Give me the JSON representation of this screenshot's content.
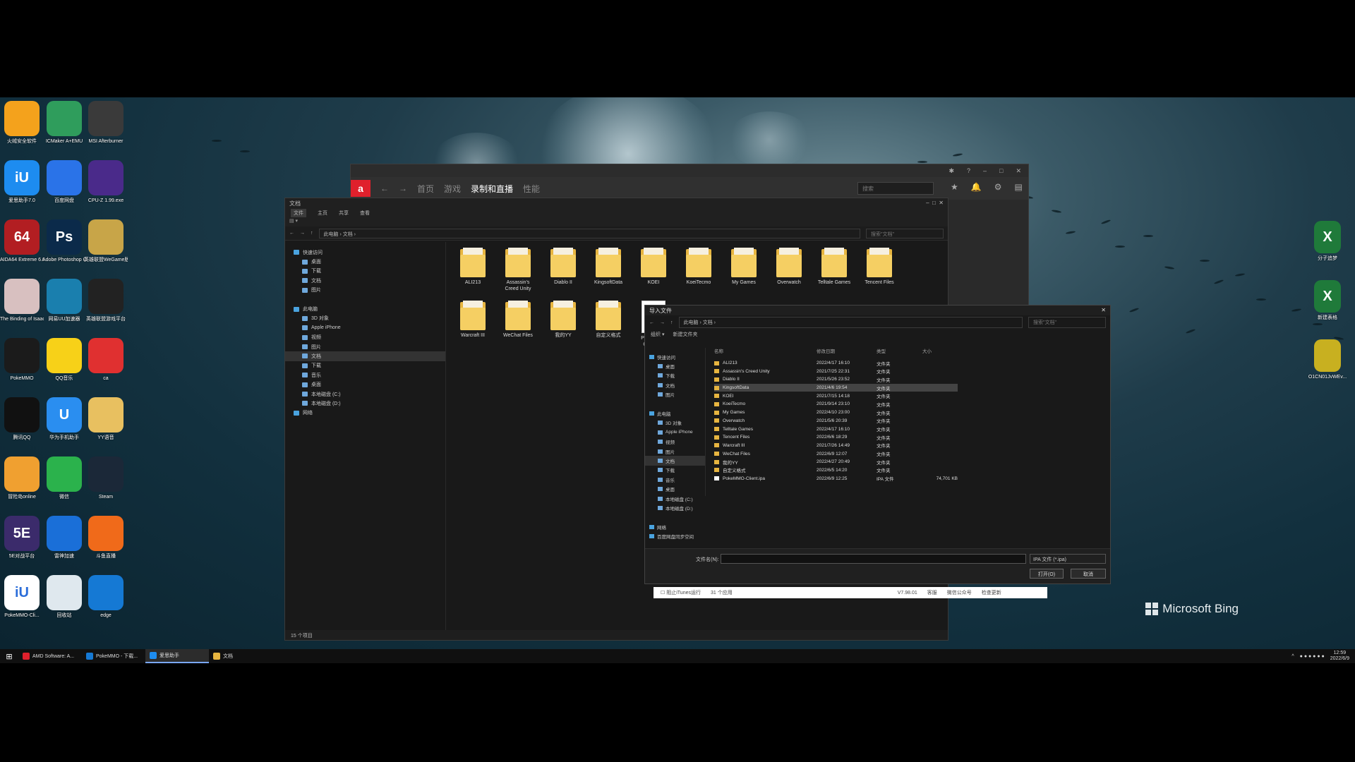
{
  "desktop": {
    "icons_left": [
      {
        "label": "火绒安全软件",
        "glyph": "",
        "color": "#f4a21c"
      },
      {
        "label": "ICMaker A+EMU",
        "glyph": "",
        "color": "#2f9d5c"
      },
      {
        "label": "MSI Afterburner",
        "glyph": "",
        "color": "#3a3a3a"
      },
      {
        "label": "爱思助手7.0",
        "glyph": "iU",
        "color": "#1d8cf0"
      },
      {
        "label": "百度网盘",
        "glyph": "",
        "color": "#2a73e8"
      },
      {
        "label": "CPU-Z 1.99.exe",
        "glyph": "",
        "color": "#4a2a8a"
      },
      {
        "label": "AIDA64 Extreme 6.60.exe",
        "glyph": "64",
        "color": "#b21e22"
      },
      {
        "label": "Adobe Photoshop CC",
        "glyph": "Ps",
        "color": "#0b2a4a"
      },
      {
        "label": "英雄联盟WeGame版",
        "glyph": "",
        "color": "#c8a548"
      },
      {
        "label": "The Binding of Isaac 启动",
        "glyph": "",
        "color": "#d8c0c0"
      },
      {
        "label": "网易UU加速器",
        "glyph": "",
        "color": "#1a7fae"
      },
      {
        "label": "英雄联盟游戏平台",
        "glyph": "",
        "color": "#222"
      },
      {
        "label": "PokeMMO",
        "glyph": "",
        "color": "#1b1b1b"
      },
      {
        "label": "QQ音乐",
        "glyph": "",
        "color": "#f7d118"
      },
      {
        "label": "ca",
        "glyph": "",
        "color": "#e03030"
      },
      {
        "label": "腾讯QQ",
        "glyph": "",
        "color": "#111"
      },
      {
        "label": "华为手机助手",
        "glyph": "U",
        "color": "#2a8ef0"
      },
      {
        "label": "YY语音",
        "glyph": "",
        "color": "#e8c060"
      },
      {
        "label": "冒险岛online",
        "glyph": "",
        "color": "#f0a030"
      },
      {
        "label": "微信",
        "glyph": "",
        "color": "#2bb24c"
      },
      {
        "label": "Steam",
        "glyph": "",
        "color": "#1b2838"
      },
      {
        "label": "5E对战平台",
        "glyph": "5E",
        "color": "#3b2b6b"
      },
      {
        "label": "雷神加速",
        "glyph": "",
        "color": "#1a6fd8"
      },
      {
        "label": "斗鱼直播",
        "glyph": "",
        "color": "#f06a1a"
      },
      {
        "label": "PokeMMO-Cli...",
        "glyph": "iU",
        "color": "#ffffff"
      },
      {
        "label": "回收站",
        "glyph": "",
        "color": "#dfe8ee"
      },
      {
        "label": "edge",
        "glyph": "",
        "color": "#1579d4"
      }
    ],
    "icons_right": [
      {
        "label": "分子追梦",
        "glyph": "X",
        "color": "#1f7a3a"
      },
      {
        "label": "新建表格",
        "glyph": "X",
        "color": "#1f7a3a"
      },
      {
        "label": "O1CN01JvWEv...",
        "glyph": "",
        "color": "#c8b020"
      }
    ],
    "bing_label": "Microsoft Bing"
  },
  "amd_window": {
    "logo": "a",
    "tabs": [
      "首页",
      "游戏",
      "录制和直播",
      "性能"
    ],
    "active_tab": "录制和直播",
    "search_placeholder": "搜索"
  },
  "explorer": {
    "title": "文档",
    "ribbon": [
      "文件",
      "主页",
      "共享",
      "查看"
    ],
    "path": [
      "此电脑",
      "文档"
    ],
    "search_placeholder": "搜索\"文档\"",
    "sidebar": [
      {
        "label": "快速访问",
        "level": 0
      },
      {
        "label": "桌面",
        "level": 1
      },
      {
        "label": "下载",
        "level": 1
      },
      {
        "label": "文档",
        "level": 1
      },
      {
        "label": "图片",
        "level": 1
      },
      {
        "label": "",
        "level": 1
      },
      {
        "label": "此电脑",
        "level": 0
      },
      {
        "label": "3D 对象",
        "level": 1
      },
      {
        "label": "Apple iPhone",
        "level": 1
      },
      {
        "label": "视频",
        "level": 1
      },
      {
        "label": "图片",
        "level": 1
      },
      {
        "label": "文档",
        "level": 1,
        "selected": true
      },
      {
        "label": "下载",
        "level": 1
      },
      {
        "label": "音乐",
        "level": 1
      },
      {
        "label": "桌面",
        "level": 1
      },
      {
        "label": "本地磁盘 (C:)",
        "level": 1
      },
      {
        "label": "本地磁盘 (D:)",
        "level": 1
      },
      {
        "label": "网络",
        "level": 0
      }
    ],
    "files": [
      {
        "name": "ALI213",
        "kind": "folder"
      },
      {
        "name": "Assassin's Creed Unity",
        "kind": "folder"
      },
      {
        "name": "Diablo II",
        "kind": "folder"
      },
      {
        "name": "KingsoftData",
        "kind": "folder"
      },
      {
        "name": "KOEI",
        "kind": "folder"
      },
      {
        "name": "KoeiTecmo",
        "kind": "folder"
      },
      {
        "name": "My Games",
        "kind": "folder"
      },
      {
        "name": "Overwatch",
        "kind": "folder"
      },
      {
        "name": "Telltale Games",
        "kind": "folder"
      },
      {
        "name": "Tencent Files",
        "kind": "folder"
      },
      {
        "name": "Warcraft III",
        "kind": "folder"
      },
      {
        "name": "WeChat Files",
        "kind": "folder"
      },
      {
        "name": "我的YY",
        "kind": "folder"
      },
      {
        "name": "自定义格式",
        "kind": "folder"
      },
      {
        "name": "PokeMMO-Client.ipa",
        "kind": "ipa"
      }
    ],
    "status": "15 个项目"
  },
  "dialog": {
    "title": "导入文件",
    "path": [
      "此电脑",
      "文档"
    ],
    "search_placeholder": "搜索\"文档\"",
    "toolbar": [
      "组织 ▾",
      "新建文件夹"
    ],
    "sidebar": [
      {
        "label": "快速访问",
        "level": 0
      },
      {
        "label": "桌面",
        "level": 1
      },
      {
        "label": "下载",
        "level": 1
      },
      {
        "label": "文档",
        "level": 1
      },
      {
        "label": "图片",
        "level": 1
      },
      {
        "label": "",
        "level": 1
      },
      {
        "label": "此电脑",
        "level": 0
      },
      {
        "label": "3D 对象",
        "level": 1
      },
      {
        "label": "Apple iPhone",
        "level": 1
      },
      {
        "label": "视频",
        "level": 1
      },
      {
        "label": "图片",
        "level": 1
      },
      {
        "label": "文档",
        "level": 1,
        "selected": true
      },
      {
        "label": "下载",
        "level": 1
      },
      {
        "label": "音乐",
        "level": 1
      },
      {
        "label": "桌面",
        "level": 1
      },
      {
        "label": "本地磁盘 (C:)",
        "level": 1
      },
      {
        "label": "本地磁盘 (D:)",
        "level": 1
      },
      {
        "label": "",
        "level": 1
      },
      {
        "label": "网络",
        "level": 0
      },
      {
        "label": "百度网盘同步空间",
        "level": 0
      }
    ],
    "columns": [
      "名称",
      "修改日期",
      "类型",
      "大小"
    ],
    "rows": [
      {
        "name": "ALI213",
        "date": "2022/4/17 16:10",
        "type": "文件夹",
        "size": "",
        "kind": "folder"
      },
      {
        "name": "Assassin's Creed Unity",
        "date": "2021/7/25 22:31",
        "type": "文件夹",
        "size": "",
        "kind": "folder"
      },
      {
        "name": "Diablo II",
        "date": "2021/5/26 23:52",
        "type": "文件夹",
        "size": "",
        "kind": "folder"
      },
      {
        "name": "KingsoftData",
        "date": "2021/4/6 19:54",
        "type": "文件夹",
        "size": "",
        "kind": "folder",
        "selected": true
      },
      {
        "name": "KOEI",
        "date": "2021/7/15 14:18",
        "type": "文件夹",
        "size": "",
        "kind": "folder"
      },
      {
        "name": "KoeiTecmo",
        "date": "2021/9/14 23:10",
        "type": "文件夹",
        "size": "",
        "kind": "folder"
      },
      {
        "name": "My Games",
        "date": "2022/4/10 23:00",
        "type": "文件夹",
        "size": "",
        "kind": "folder"
      },
      {
        "name": "Overwatch",
        "date": "2021/5/6 20:39",
        "type": "文件夹",
        "size": "",
        "kind": "folder"
      },
      {
        "name": "Telltale Games",
        "date": "2022/4/17 16:10",
        "type": "文件夹",
        "size": "",
        "kind": "folder"
      },
      {
        "name": "Tencent Files",
        "date": "2022/6/6 18:29",
        "type": "文件夹",
        "size": "",
        "kind": "folder"
      },
      {
        "name": "Warcraft III",
        "date": "2021/7/26 14:49",
        "type": "文件夹",
        "size": "",
        "kind": "folder"
      },
      {
        "name": "WeChat Files",
        "date": "2022/6/9 12:07",
        "type": "文件夹",
        "size": "",
        "kind": "folder"
      },
      {
        "name": "我的YY",
        "date": "2022/4/27 20:49",
        "type": "文件夹",
        "size": "",
        "kind": "folder"
      },
      {
        "name": "自定义格式",
        "date": "2022/6/5 14:20",
        "type": "文件夹",
        "size": "",
        "kind": "folder"
      },
      {
        "name": "PokeMMO-Client.ipa",
        "date": "2022/6/9 12:25",
        "type": "IPA 文件",
        "size": "74,701 KB",
        "kind": "file"
      }
    ],
    "filename_label": "文件名(N):",
    "filename_value": "",
    "filetype": "IPA 文件 (*.ipa)",
    "open_button": "打开(O)",
    "cancel_button": "取消"
  },
  "strip": {
    "items": [
      "阻止iTunes运行",
      "31 个应用",
      "V7.98.01",
      "客服",
      "微信公众号",
      "检查更新"
    ]
  },
  "taskbar": {
    "start": "⊞",
    "tasks": [
      {
        "label": "AMD Software: A...",
        "color": "#e0202c"
      },
      {
        "label": "PokeMMO - 下载...",
        "color": "#1579d4"
      },
      {
        "label": "爱思助手",
        "color": "#1d8cf0",
        "active": true
      },
      {
        "label": "文档",
        "color": "#e7b540"
      }
    ],
    "time": "12:59",
    "date": "2022/6/9"
  }
}
